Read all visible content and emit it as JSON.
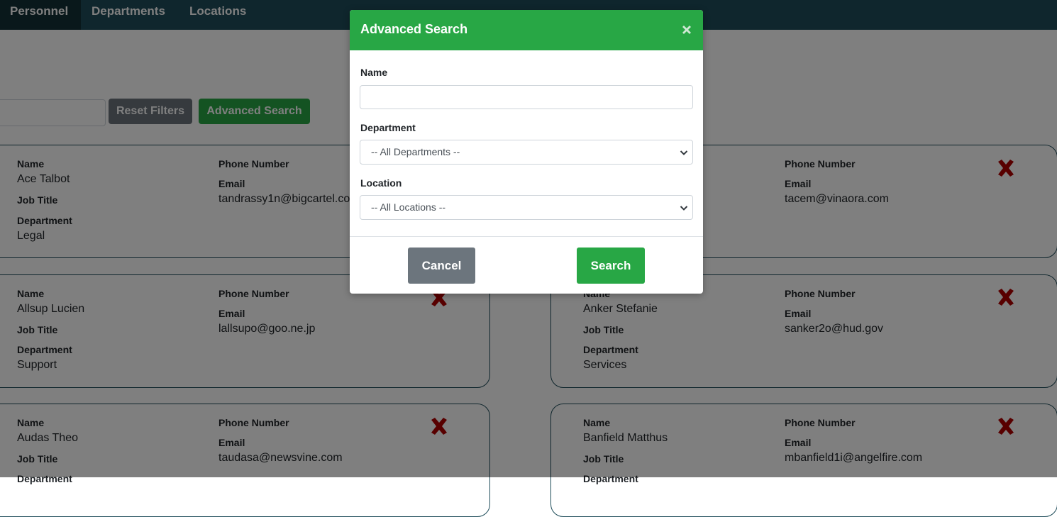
{
  "nav": {
    "tabs": [
      {
        "label": "Personnel",
        "active": true
      },
      {
        "label": "Departments",
        "active": false
      },
      {
        "label": "Locations",
        "active": false
      }
    ]
  },
  "toolbar": {
    "search_value": "",
    "reset_label": "Reset Filters",
    "advanced_label": "Advanced Search"
  },
  "labels": {
    "name": "Name",
    "job_title": "Job Title",
    "department": "Department",
    "phone": "Phone Number",
    "email": "Email"
  },
  "cards": [
    {
      "name": "Ace Talbot",
      "job_title": "",
      "department": "Legal",
      "phone": "",
      "email": "tandrassy1n@bigcartel.com"
    },
    {
      "name": "",
      "job_title": "",
      "department": "",
      "phone": "",
      "email": "tacem@vinaora.com"
    },
    {
      "name": "Allsup Lucien",
      "job_title": "",
      "department": "Support",
      "phone": "",
      "email": "lallsupo@goo.ne.jp"
    },
    {
      "name": "Anker Stefanie",
      "job_title": "",
      "department": "Services",
      "phone": "",
      "email": "sanker2o@hud.gov"
    },
    {
      "name": "Audas Theo",
      "job_title": "",
      "department": "",
      "phone": "",
      "email": "taudasa@newsvine.com"
    },
    {
      "name": "Banfield Matthus",
      "job_title": "",
      "department": "",
      "phone": "",
      "email": "mbanfield1i@angelfire.com"
    }
  ],
  "modal": {
    "title": "Advanced Search",
    "name_label": "Name",
    "name_value": "",
    "department_label": "Department",
    "department_selected": "-- All Departments --",
    "location_label": "Location",
    "location_selected": "-- All Locations --",
    "cancel_label": "Cancel",
    "search_label": "Search"
  },
  "colors": {
    "nav_bg": "#1f4d5a",
    "accent_green": "#28a745",
    "secondary_gray": "#6c757d",
    "delete_red": "#b00000"
  },
  "icons": {
    "delete": "close-x-icon",
    "modal_close": "close-icon",
    "select_arrow": "chevron-down-icon"
  }
}
